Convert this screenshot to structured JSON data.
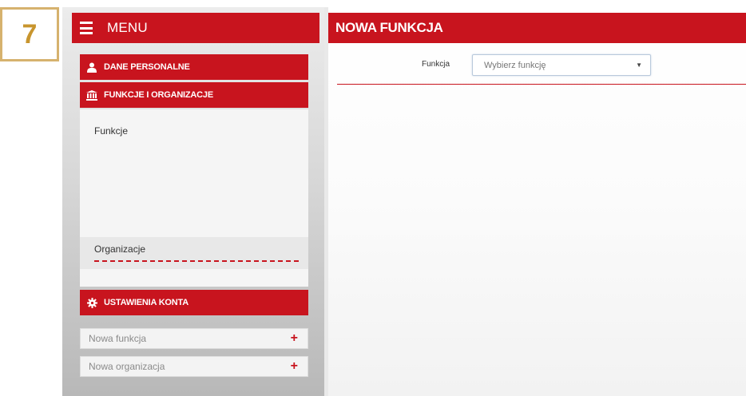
{
  "step_badge": "7",
  "sidebar": {
    "menu_title": "MENU",
    "sections": [
      {
        "label": "DANE PERSONALNE",
        "icon": "user-icon"
      },
      {
        "label": "FUNKCJE I ORGANIZACJE",
        "icon": "institution-icon"
      }
    ],
    "submenu": [
      {
        "label": "Funkcje"
      },
      {
        "label": "Organizacje"
      }
    ],
    "settings": {
      "label": "USTAWIENIA KONTA",
      "icon": "gear-icon"
    },
    "actions": [
      {
        "label": "Nowa funkcja",
        "icon": "plus-icon"
      },
      {
        "label": "Nowa organizacja",
        "icon": "plus-icon"
      }
    ]
  },
  "main": {
    "title": "NOWA FUNKCJA",
    "field_label": "Funkcja",
    "select_value": "Wybierz funkcję"
  },
  "colors": {
    "accent": "#c8141e",
    "badge": "#c8952e"
  }
}
